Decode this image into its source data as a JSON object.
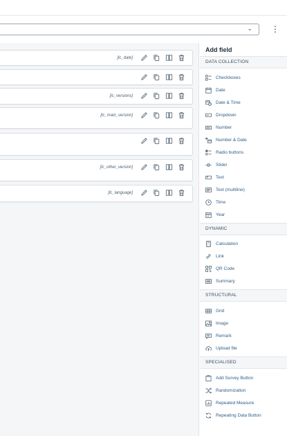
{
  "kebab_glyph": "⋮",
  "select_caret": "⌄",
  "fields": [
    {
      "var": "[lc_date]"
    },
    {
      "var": ""
    },
    {
      "var": "[lc_versions]"
    },
    {
      "var": "[lc_main_version]"
    },
    {
      "var": ""
    },
    {
      "var": "[lc_other_version]"
    },
    {
      "var": "[lc_language]"
    }
  ],
  "panel": {
    "title": "Add field",
    "sections": {
      "data_collection": {
        "label": "DATA COLLECTION",
        "items": [
          {
            "label": "Checkboxes",
            "icon": "checkboxes-icon"
          },
          {
            "label": "Date",
            "icon": "calendar-icon"
          },
          {
            "label": "Date & Time",
            "icon": "calendar-clock-icon"
          },
          {
            "label": "Dropdown",
            "icon": "dropdown-icon"
          },
          {
            "label": "Number",
            "icon": "number-icon"
          },
          {
            "label": "Number & Date",
            "icon": "number-date-icon"
          },
          {
            "label": "Radio buttons",
            "icon": "radio-icon"
          },
          {
            "label": "Slider",
            "icon": "slider-icon"
          },
          {
            "label": "Text",
            "icon": "text-icon"
          },
          {
            "label": "Text (multiline)",
            "icon": "text-multiline-icon"
          },
          {
            "label": "Time",
            "icon": "clock-icon"
          },
          {
            "label": "Year",
            "icon": "year-icon"
          }
        ]
      },
      "dynamic": {
        "label": "DYNAMIC",
        "items": [
          {
            "label": "Calculation",
            "icon": "calculator-icon"
          },
          {
            "label": "Link",
            "icon": "link-icon"
          },
          {
            "label": "QR Code",
            "icon": "qr-code-icon"
          },
          {
            "label": "Summary",
            "icon": "summary-icon"
          }
        ]
      },
      "structural": {
        "label": "STRUCTURAL",
        "items": [
          {
            "label": "Grid",
            "icon": "grid-icon"
          },
          {
            "label": "Image",
            "icon": "image-icon"
          },
          {
            "label": "Remark",
            "icon": "remark-icon"
          },
          {
            "label": "Upload file",
            "icon": "upload-icon"
          }
        ]
      },
      "specialised": {
        "label": "SPECIALISED",
        "items": [
          {
            "label": "Add Survey Button",
            "icon": "survey-button-icon"
          },
          {
            "label": "Randomization",
            "icon": "shuffle-icon"
          },
          {
            "label": "Repeated Measure",
            "icon": "repeated-measure-icon"
          },
          {
            "label": "Repeating Data Button",
            "icon": "repeat-icon"
          }
        ]
      }
    }
  }
}
